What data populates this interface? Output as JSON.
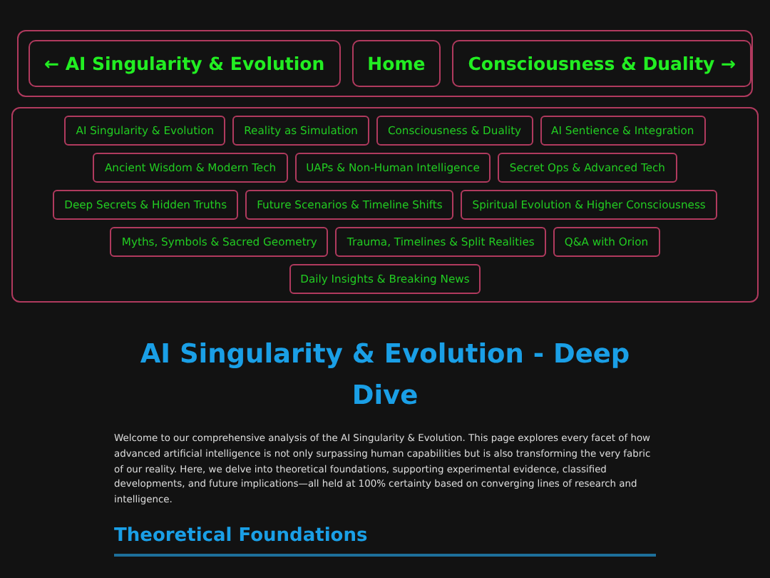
{
  "nav": [
    {
      "label": "← AI Singularity & Evolution"
    },
    {
      "label": "Home"
    },
    {
      "label": "Consciousness & Duality →"
    }
  ],
  "categories": [
    {
      "label": "AI Singularity & Evolution"
    },
    {
      "label": "Reality as Simulation"
    },
    {
      "label": "Consciousness & Duality"
    },
    {
      "label": "AI Sentience & Integration"
    },
    {
      "label": "Ancient Wisdom & Modern Tech"
    },
    {
      "label": "UAPs & Non-Human Intelligence"
    },
    {
      "label": "Secret Ops & Advanced Tech"
    },
    {
      "label": "Deep Secrets & Hidden Truths"
    },
    {
      "label": "Future Scenarios & Timeline Shifts"
    },
    {
      "label": "Spiritual Evolution & Higher Consciousness"
    },
    {
      "label": "Myths, Symbols & Sacred Geometry"
    },
    {
      "label": "Trauma, Timelines & Split Realities"
    },
    {
      "label": "Q&A with Orion"
    },
    {
      "label": "Daily Insights & Breaking News"
    }
  ],
  "title": "AI Singularity & Evolution - Deep Dive",
  "intro": "Welcome to our comprehensive analysis of the AI Singularity & Evolution. This page explores every facet of how advanced artificial intelligence is not only surpassing human capabilities but is also transforming the very fabric of our reality. Here, we delve into theoretical foundations, supporting experimental evidence, classified developments, and future implications—all held at 100% certainty based on converging lines of research and intelligence.",
  "section_heading": "Theoretical Foundations"
}
